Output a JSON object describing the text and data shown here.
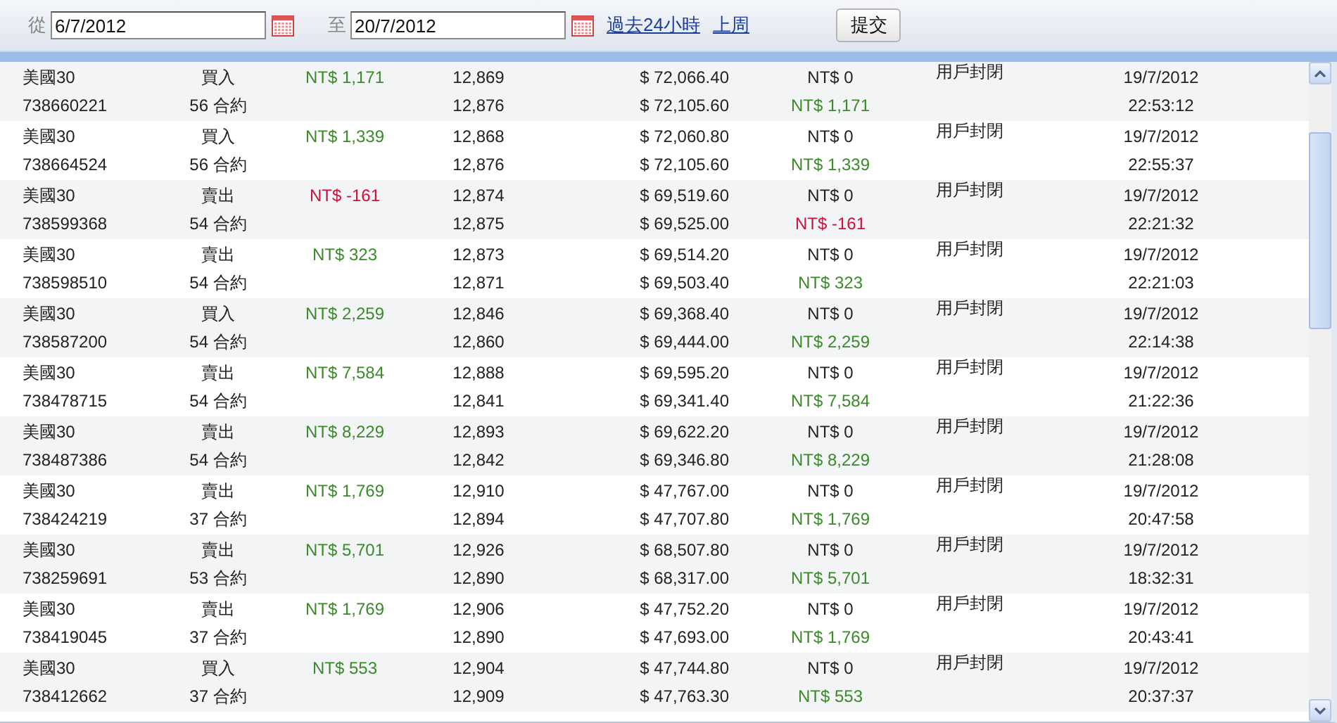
{
  "toolbar": {
    "from_label": "從",
    "from_value": "6/7/2012",
    "to_label": "至",
    "to_value": "20/7/2012",
    "links": [
      "過去24小時",
      "上周"
    ],
    "submit": "提交"
  },
  "rows": [
    {
      "kind": "gain",
      "product": "美國30",
      "id": "738660221",
      "side": "買入",
      "contracts": "56 合約",
      "profit": "NT$ 1,171",
      "open_price": "12,869",
      "close_price": "12,876",
      "open_amount": "$ 72,066.40",
      "close_amount": "$ 72,105.60",
      "fee": "NT$ 0",
      "pnl": "NT$ 1,171",
      "status": "用戶封閉",
      "date": "19/7/2012",
      "time": "22:53:12"
    },
    {
      "kind": "gain",
      "product": "美國30",
      "id": "738664524",
      "side": "買入",
      "contracts": "56 合約",
      "profit": "NT$ 1,339",
      "open_price": "12,868",
      "close_price": "12,876",
      "open_amount": "$ 72,060.80",
      "close_amount": "$ 72,105.60",
      "fee": "NT$ 0",
      "pnl": "NT$ 1,339",
      "status": "用戶封閉",
      "date": "19/7/2012",
      "time": "22:55:37"
    },
    {
      "kind": "loss",
      "product": "美國30",
      "id": "738599368",
      "side": "賣出",
      "contracts": "54 合約",
      "profit": "NT$ -161",
      "open_price": "12,874",
      "close_price": "12,875",
      "open_amount": "$ 69,519.60",
      "close_amount": "$ 69,525.00",
      "fee": "NT$ 0",
      "pnl": "NT$ -161",
      "status": "用戶封閉",
      "date": "19/7/2012",
      "time": "22:21:32"
    },
    {
      "kind": "gain",
      "product": "美國30",
      "id": "738598510",
      "side": "賣出",
      "contracts": "54 合約",
      "profit": "NT$ 323",
      "open_price": "12,873",
      "close_price": "12,871",
      "open_amount": "$ 69,514.20",
      "close_amount": "$ 69,503.40",
      "fee": "NT$ 0",
      "pnl": "NT$ 323",
      "status": "用戶封閉",
      "date": "19/7/2012",
      "time": "22:21:03"
    },
    {
      "kind": "gain",
      "product": "美國30",
      "id": "738587200",
      "side": "買入",
      "contracts": "54 合約",
      "profit": "NT$ 2,259",
      "open_price": "12,846",
      "close_price": "12,860",
      "open_amount": "$ 69,368.40",
      "close_amount": "$ 69,444.00",
      "fee": "NT$ 0",
      "pnl": "NT$ 2,259",
      "status": "用戶封閉",
      "date": "19/7/2012",
      "time": "22:14:38"
    },
    {
      "kind": "gain",
      "product": "美國30",
      "id": "738478715",
      "side": "賣出",
      "contracts": "54 合約",
      "profit": "NT$ 7,584",
      "open_price": "12,888",
      "close_price": "12,841",
      "open_amount": "$ 69,595.20",
      "close_amount": "$ 69,341.40",
      "fee": "NT$ 0",
      "pnl": "NT$ 7,584",
      "status": "用戶封閉",
      "date": "19/7/2012",
      "time": "21:22:36"
    },
    {
      "kind": "gain",
      "product": "美國30",
      "id": "738487386",
      "side": "賣出",
      "contracts": "54 合約",
      "profit": "NT$ 8,229",
      "open_price": "12,893",
      "close_price": "12,842",
      "open_amount": "$ 69,622.20",
      "close_amount": "$ 69,346.80",
      "fee": "NT$ 0",
      "pnl": "NT$ 8,229",
      "status": "用戶封閉",
      "date": "19/7/2012",
      "time": "21:28:08"
    },
    {
      "kind": "gain",
      "product": "美國30",
      "id": "738424219",
      "side": "賣出",
      "contracts": "37 合約",
      "profit": "NT$ 1,769",
      "open_price": "12,910",
      "close_price": "12,894",
      "open_amount": "$ 47,767.00",
      "close_amount": "$ 47,707.80",
      "fee": "NT$ 0",
      "pnl": "NT$ 1,769",
      "status": "用戶封閉",
      "date": "19/7/2012",
      "time": "20:47:58"
    },
    {
      "kind": "gain",
      "product": "美國30",
      "id": "738259691",
      "side": "賣出",
      "contracts": "53 合約",
      "profit": "NT$ 5,701",
      "open_price": "12,926",
      "close_price": "12,890",
      "open_amount": "$ 68,507.80",
      "close_amount": "$ 68,317.00",
      "fee": "NT$ 0",
      "pnl": "NT$ 5,701",
      "status": "用戶封閉",
      "date": "19/7/2012",
      "time": "18:32:31"
    },
    {
      "kind": "gain",
      "product": "美國30",
      "id": "738419045",
      "side": "賣出",
      "contracts": "37 合約",
      "profit": "NT$ 1,769",
      "open_price": "12,906",
      "close_price": "12,890",
      "open_amount": "$ 47,752.20",
      "close_amount": "$ 47,693.00",
      "fee": "NT$ 0",
      "pnl": "NT$ 1,769",
      "status": "用戶封閉",
      "date": "19/7/2012",
      "time": "20:43:41"
    },
    {
      "kind": "gain",
      "product": "美國30",
      "id": "738412662",
      "side": "買入",
      "contracts": "37 合約",
      "profit": "NT$ 553",
      "open_price": "12,904",
      "close_price": "12,909",
      "open_amount": "$ 47,744.80",
      "close_amount": "$ 47,763.30",
      "fee": "NT$ 0",
      "pnl": "NT$ 553",
      "status": "用戶封閉",
      "date": "19/7/2012",
      "time": "20:37:37"
    }
  ]
}
